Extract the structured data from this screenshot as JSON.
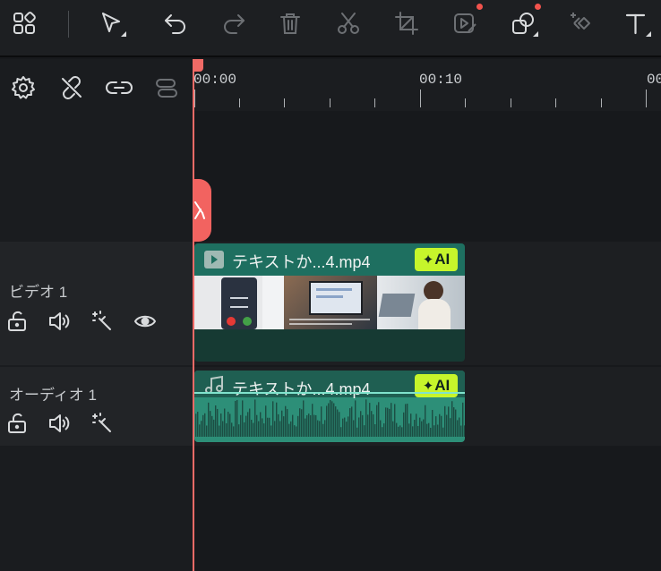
{
  "toolbar": {
    "icons": [
      "grid-icon",
      "select-arrow-icon",
      "undo-icon",
      "redo-icon",
      "trash-icon",
      "scissors-icon",
      "crop-icon",
      "media-replace-icon",
      "shapes-icon",
      "keyframe-icon",
      "text-icon"
    ]
  },
  "ruler": {
    "times": [
      "00:00",
      "00:10",
      "00"
    ]
  },
  "tracks": {
    "video": {
      "name": "ビデオ 1",
      "clip_title": "テキストか...4.mp4",
      "ai_label": "AI"
    },
    "audio": {
      "name": "オーディオ 1",
      "clip_title": "テキストか...4.mp4",
      "ai_label": "AI"
    }
  },
  "colors": {
    "playhead": "#f06a66",
    "video_clip": "#1e6f60",
    "audio_clip": "#2d8f78",
    "ai_badge": "#c6f52b"
  }
}
